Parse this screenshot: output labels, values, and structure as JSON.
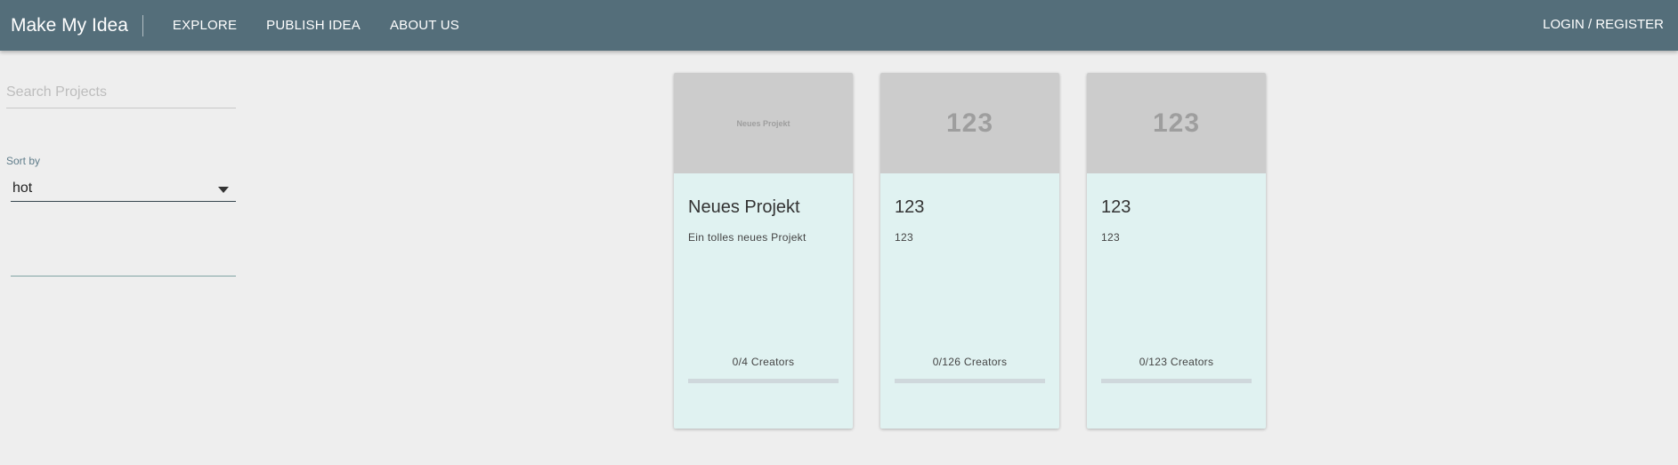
{
  "header": {
    "brand": "Make My Idea",
    "nav": [
      "EXPLORE",
      "PUBLISH IDEA",
      "ABOUT US"
    ],
    "login": "LOGIN / REGISTER"
  },
  "sidebar": {
    "search_placeholder": "Search Projects",
    "sort_label": "Sort by",
    "sort_value": "hot"
  },
  "cards": [
    {
      "image_text": "Neues Projekt",
      "title": "Neues Projekt",
      "description": "Ein tolles neues Projekt",
      "creators": "0/4 Creators",
      "progress": 0
    },
    {
      "image_text": "123",
      "title": "123",
      "description": "123",
      "creators": "0/126 Creators",
      "progress": 0
    },
    {
      "image_text": "123",
      "title": "123",
      "description": "123",
      "creators": "0/123 Creators",
      "progress": 0
    }
  ],
  "colors": {
    "header": "#546e7a",
    "background": "#eeeeee",
    "card": "#e0f2f1",
    "card_image": "#cccccc"
  }
}
